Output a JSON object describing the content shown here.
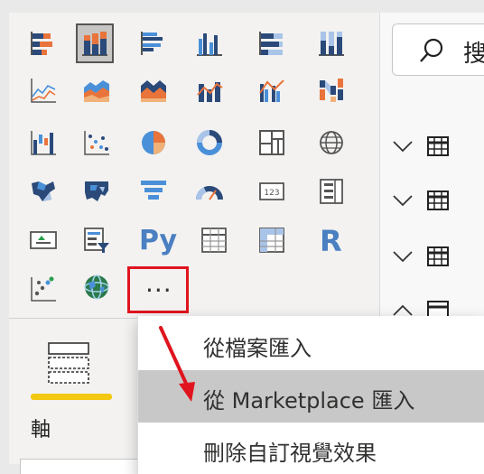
{
  "visual_gallery": {
    "icons": [
      "stacked-bar-chart-icon",
      "stacked-column-chart-icon",
      "clustered-bar-chart-icon",
      "clustered-column-chart-icon",
      "100-stacked-bar-chart-icon",
      "100-stacked-column-chart-icon",
      "line-chart-icon",
      "area-chart-icon",
      "stacked-area-chart-icon",
      "line-and-stacked-column-icon",
      "line-and-clustered-column-icon",
      "ribbon-chart-icon",
      "waterfall-chart-icon",
      "scatter-chart-icon",
      "pie-chart-icon",
      "donut-chart-icon",
      "treemap-icon",
      "map-icon",
      "filled-map-icon",
      "shape-map-icon",
      "funnel-icon",
      "gauge-icon",
      "card-icon",
      "multi-row-card-icon",
      "kpi-icon",
      "slicer-icon",
      "python-visual-icon",
      "table-icon",
      "matrix-icon",
      "r-visual-icon",
      "key-influencers-icon",
      "arcgis-map-icon"
    ],
    "python_label": "Py",
    "r_label": "R",
    "more_label": "···"
  },
  "fields_pane": {
    "axis_label": "軸"
  },
  "right_panel": {
    "search_partial": "搜",
    "tables": [
      {
        "expanded": false
      },
      {
        "expanded": false
      },
      {
        "expanded": false
      },
      {
        "expanded": true
      }
    ]
  },
  "context_menu": {
    "items": [
      {
        "label": "從檔案匯入"
      },
      {
        "label": "從 Marketplace 匯入"
      },
      {
        "label": "刪除自訂視覺效果"
      }
    ]
  },
  "colors": {
    "accent_yellow": "#f2c811",
    "highlight_red": "#e0141e",
    "orange": "#e8743b",
    "blue": "#4a90d9",
    "navy": "#2b4a7a"
  }
}
